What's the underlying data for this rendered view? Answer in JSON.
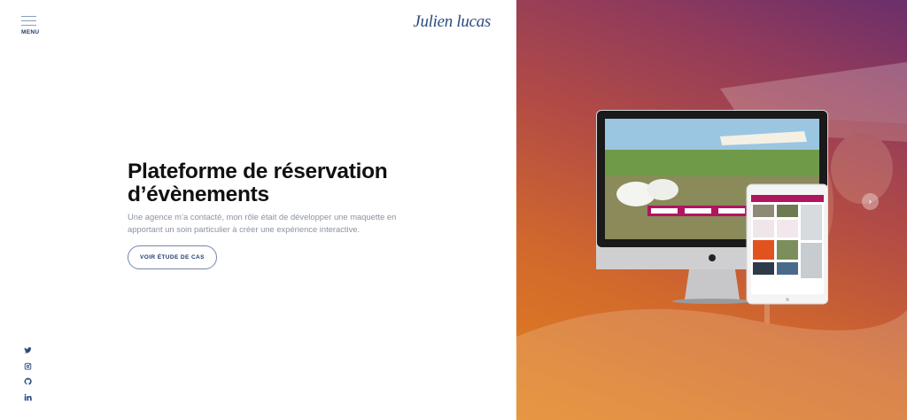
{
  "header": {
    "menu_label": "MENU",
    "logo": "Julien lucas"
  },
  "hero": {
    "title_line1": "Plateforme de réservation",
    "title_line2": "d’évènements",
    "description_line1": "Une agence m’a contacté, mon rôle était de développer une maquette en",
    "description_line2": "apportant un soin particulier à créer une expérience interactive.",
    "cta_label": "VOIR ÉTUDE DE CAS"
  },
  "socials": [
    {
      "icon": "twitter-icon"
    },
    {
      "icon": "instagram-icon"
    },
    {
      "icon": "github-icon"
    },
    {
      "icon": "linkedin-icon"
    }
  ],
  "slider": {
    "next_icon": "chevron-right-icon"
  },
  "colors": {
    "accent": "#2b4c80",
    "gradient_start": "#6a2f6b",
    "gradient_end": "#e3821c",
    "mockup_accent": "#b0155f"
  }
}
